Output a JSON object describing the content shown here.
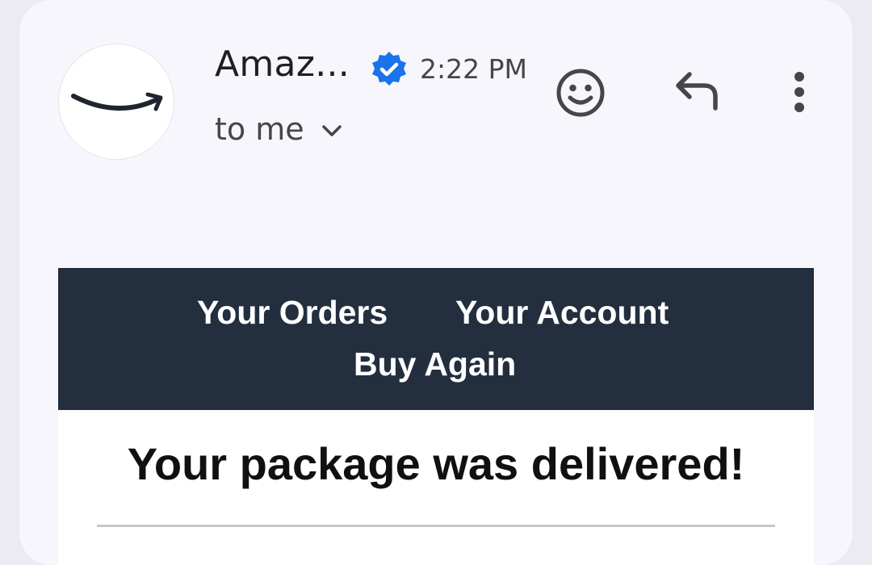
{
  "header": {
    "sender_name": "Amaz...",
    "time": "2:22 PM",
    "recipient": "to me",
    "verified": true
  },
  "icons": {
    "avatar": "amazon-smile-logo",
    "verified": "verified-badge-icon",
    "chevron": "chevron-down-icon",
    "emoji": "emoji-smile-icon",
    "reply": "reply-icon",
    "more": "more-vertical-icon"
  },
  "email": {
    "nav": {
      "orders": "Your Orders",
      "account": "Your Account",
      "buy_again": "Buy Again"
    },
    "headline": "Your package was delivered!"
  },
  "colors": {
    "nav_bg": "#232f3e",
    "verified_blue": "#1a73e8",
    "card_bg": "#f7f6fc"
  }
}
